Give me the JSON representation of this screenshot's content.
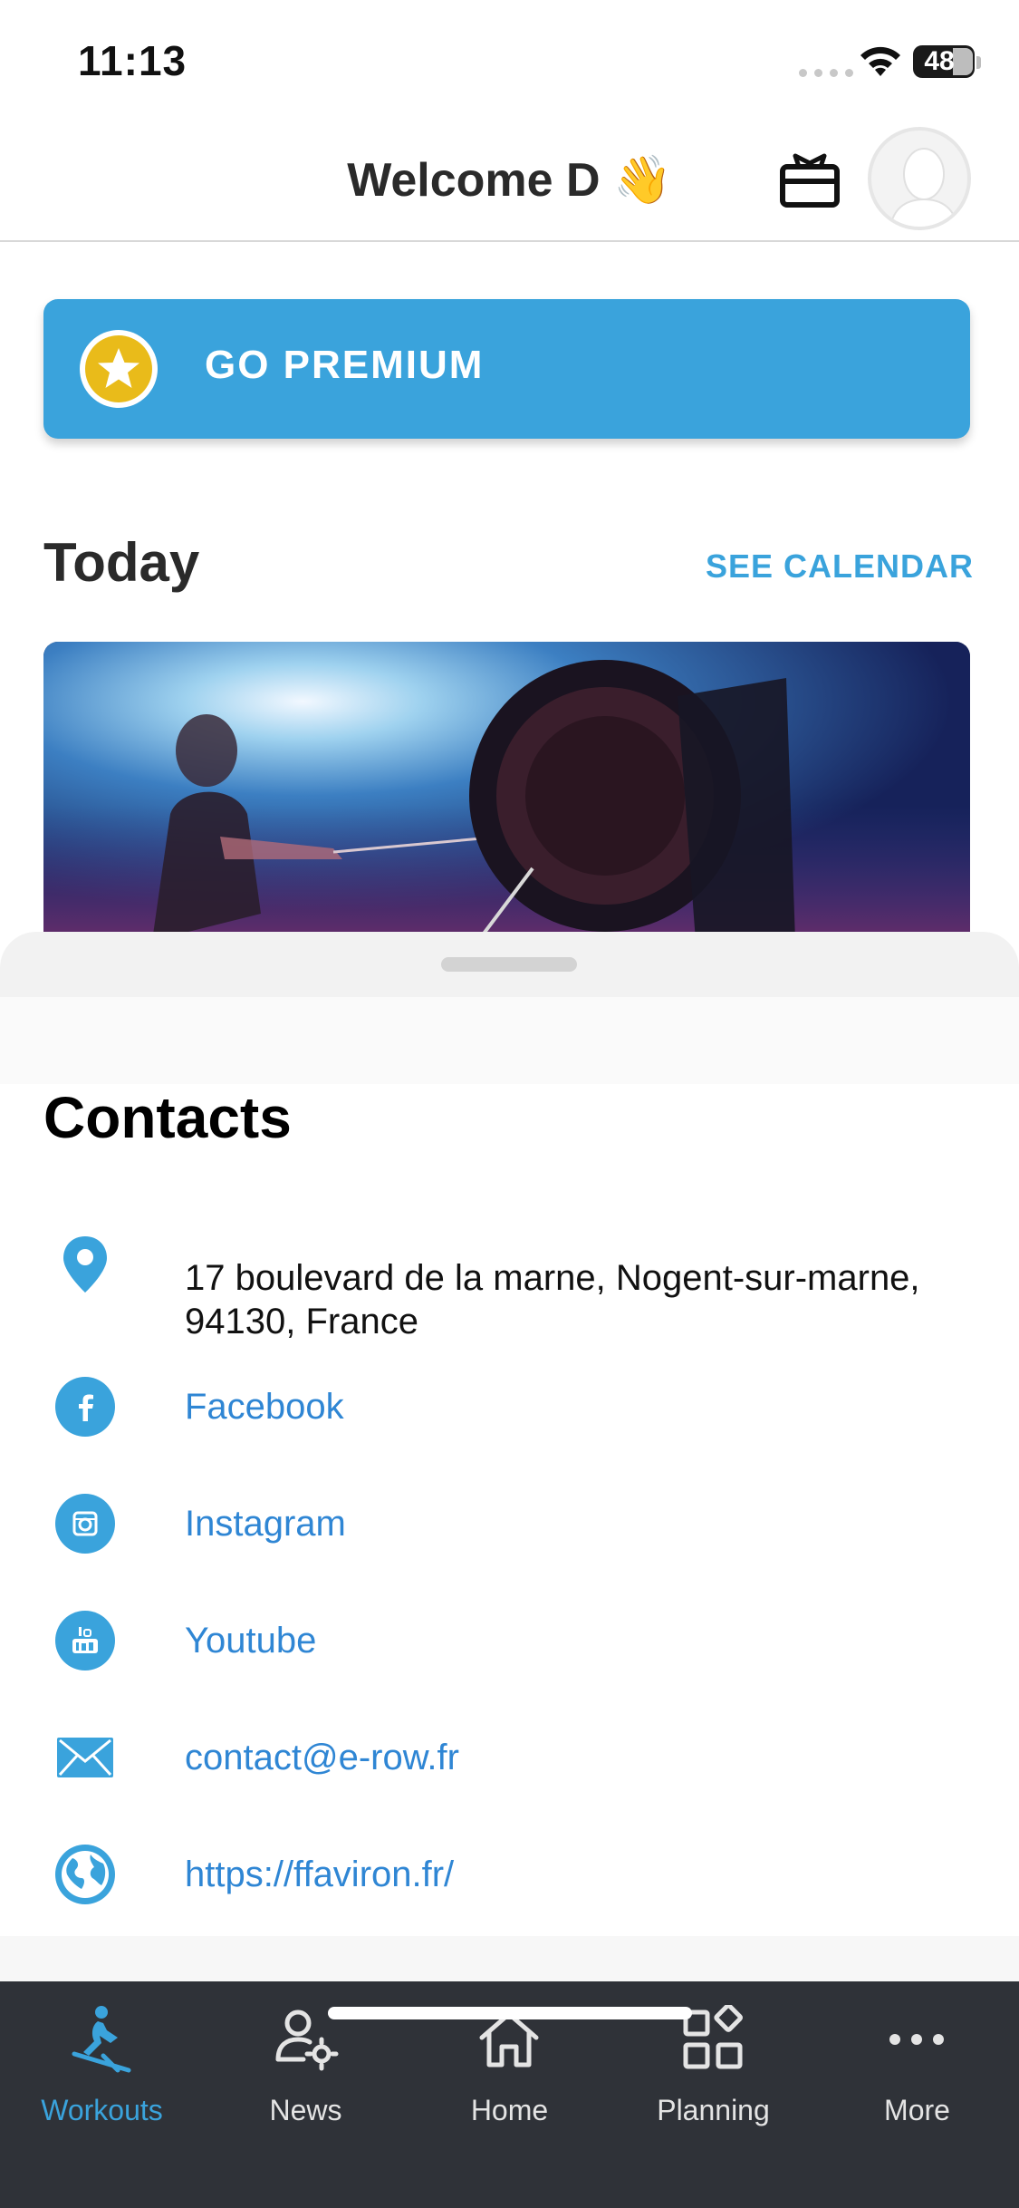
{
  "status_bar": {
    "time": "11:13",
    "battery": "48",
    "battery_level": 0.48
  },
  "header": {
    "title": "Welcome D 👋"
  },
  "premium": {
    "label": "GO PREMIUM"
  },
  "today": {
    "title": "Today",
    "see_calendar": "SEE CALENDAR"
  },
  "contacts": {
    "title": "Contacts",
    "address": "17 boulevard de la marne, Nogent-sur-marne, 94130, France",
    "facebook": "Facebook",
    "instagram": "Instagram",
    "youtube": "Youtube",
    "email": "contact@e-row.fr",
    "website": "https://ffaviron.fr/"
  },
  "tabs": [
    {
      "label": "Workouts",
      "icon": "rower-icon",
      "active": true
    },
    {
      "label": "News",
      "icon": "users-gear-icon",
      "active": false
    },
    {
      "label": "Home",
      "icon": "home-icon",
      "active": false
    },
    {
      "label": "Planning",
      "icon": "grid-icon",
      "active": false
    },
    {
      "label": "More",
      "icon": "ellipsis-icon",
      "active": false
    }
  ],
  "colors": {
    "accent": "#3aa3dc",
    "link": "#2f86d4",
    "tab_bar": "#2f3238",
    "badge": "#e9bb1a"
  }
}
